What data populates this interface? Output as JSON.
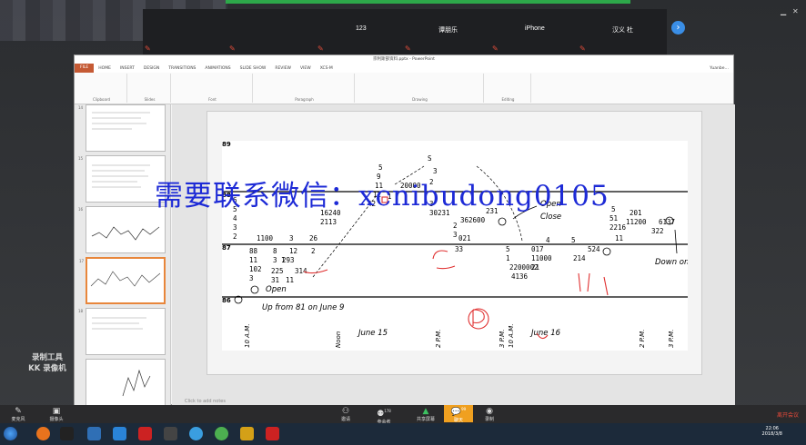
{
  "participants": [
    {
      "name": "123"
    },
    {
      "name": "谭朋乐"
    },
    {
      "name": "iPhone"
    },
    {
      "name": "汉义 杜"
    }
  ],
  "ppt": {
    "title": "宗利斯部资料.pptx - PowerPoint",
    "user": "Yuanbe…",
    "tabs": [
      "FILE",
      "HOME",
      "INSERT",
      "DESIGN",
      "TRANSITIONS",
      "ANIMATIONS",
      "SLIDE SHOW",
      "REVIEW",
      "VIEW",
      "XCS·M"
    ],
    "ribbon_groups": [
      "Clipboard",
      "Slides",
      "Font",
      "Paragraph",
      "Drawing",
      "Editing"
    ],
    "notes_placeholder": "Click to add notes",
    "slide_numbers": [
      "14",
      "15",
      "16",
      "17",
      "18"
    ]
  },
  "slide_chart": {
    "row_labels": [
      "89",
      "88",
      "87",
      "86"
    ],
    "annotations": [
      "Open",
      "Close",
      "Open",
      "Up from 81 on June 9",
      "Down on Jun",
      "June 15",
      "June 16",
      "Noon",
      "2 P.M.",
      "3 P.M.",
      "10 A.M."
    ],
    "watermark": "需要联系微信：xcnibudong0105"
  },
  "overlay": {
    "line1": "录制工具",
    "line2": "KK 录像机"
  },
  "meeting_bar": {
    "buttons": [
      {
        "label": "麦克风",
        "icon": "mic-icon"
      },
      {
        "label": "摄像头",
        "icon": "camera-icon"
      },
      {
        "label": "邀请",
        "icon": "invite-icon"
      },
      {
        "label": "参会者",
        "icon": "participants-icon",
        "badge": "178"
      },
      {
        "label": "共享屏幕",
        "icon": "share-icon"
      },
      {
        "label": "聊天",
        "icon": "chat-icon",
        "badge": "99"
      },
      {
        "label": "录制",
        "icon": "record-icon"
      }
    ],
    "leave_label": "离开会议"
  },
  "clock": {
    "time": "22:06",
    "date": "2018/3/8"
  }
}
